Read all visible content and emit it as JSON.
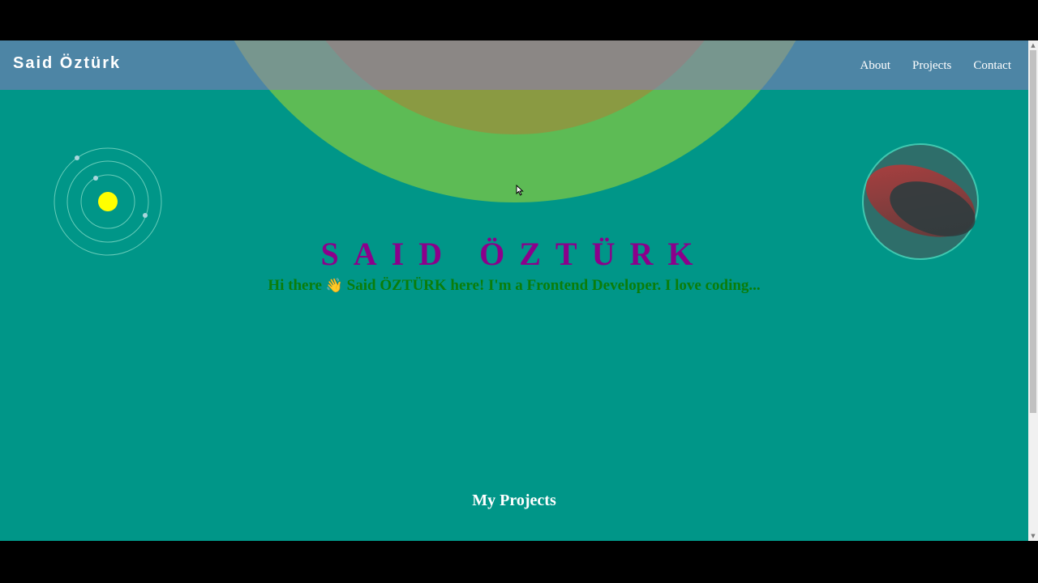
{
  "nav": {
    "brand": "Said Öztürk",
    "links": [
      "About",
      "Projects",
      "Contact"
    ]
  },
  "hero": {
    "name": "SAID ÖZTÜRK",
    "greeting_start": "Hi there",
    "wave_emoji": "👋",
    "greeting_end": "Said ÖZTÜRK here! I'm a Frontend Developer. I love coding..."
  },
  "projects": {
    "title": "My Projects"
  },
  "colors": {
    "background": "#009688",
    "accent_name": "#8b008b",
    "subtitle": "#0a7d0a",
    "arc_outer": "#5dbb55",
    "arc_inner": "#8a9a42",
    "sun": "#ffff00"
  },
  "icons": [
    "solar-system-icon",
    "sphere-icon",
    "wave-icon",
    "cursor-icon"
  ]
}
